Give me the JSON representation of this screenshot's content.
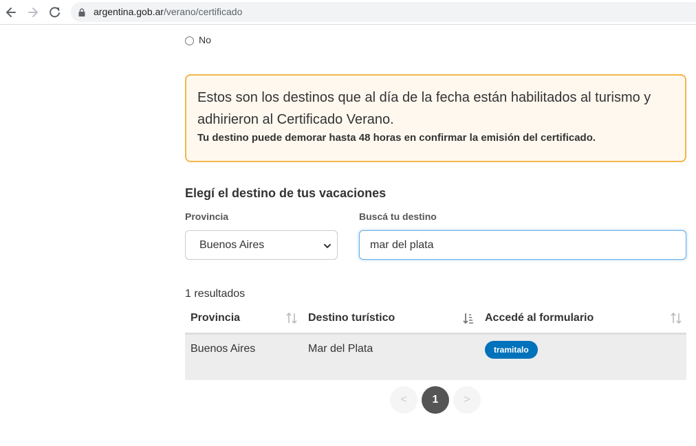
{
  "browser": {
    "url_domain": "argentina.gob.ar",
    "url_path": "/verano/certificado"
  },
  "radio": {
    "label": "No"
  },
  "alert": {
    "line1": "Estos son los destinos que al día de la fecha están habilitados al turismo y",
    "line2": "adhirieron al Certificado Verano.",
    "strong": "Tu destino puede demorar hasta 48 horas en confirmar la emisión del certificado."
  },
  "form": {
    "title": "Elegí el destino de tus vacaciones",
    "province_label": "Provincia",
    "province_value": "Buenos Aires",
    "search_label": "Buscá tu destino",
    "search_value": "mar del plata"
  },
  "results": {
    "count_text": "1 resultados",
    "headers": [
      "Provincia",
      "Destino turístico",
      "Accedé al formulario"
    ],
    "rows": [
      {
        "provincia": "Buenos Aires",
        "destino": "Mar del Plata",
        "action": "tramitalo"
      }
    ]
  },
  "pagination": {
    "prev": "<",
    "current": "1",
    "next": ">"
  },
  "colors": {
    "alert_border": "#f2b54a",
    "badge": "#0072bb",
    "pager_active": "#555555"
  }
}
